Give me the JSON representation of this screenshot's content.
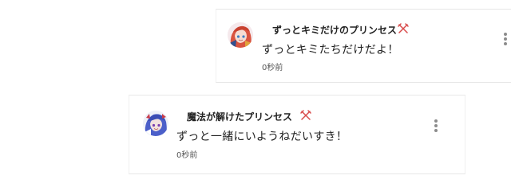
{
  "comments": [
    {
      "author_name": "ずっとキミだけのプリンセス",
      "message": "ずっとキミたちだけだよ！",
      "timestamp": "0秒前",
      "avatar_icon": "avatar-red-hair-character-icon",
      "badge_icon": "crossed-swords-badge-icon"
    },
    {
      "author_name": "魔法が解けたプリンセス",
      "message": "ずっと一緒にいようねだいすき！",
      "timestamp": "0秒前",
      "avatar_icon": "avatar-blue-hair-character-icon",
      "badge_icon": "crossed-swords-badge-icon"
    }
  ],
  "colors": {
    "card_background": "#ffffff",
    "border": "#e7e7e7",
    "text_primary": "#222222",
    "text_secondary": "#555555",
    "menu_dots": "#8c8c8c",
    "badge_red": "#d84a4a"
  }
}
